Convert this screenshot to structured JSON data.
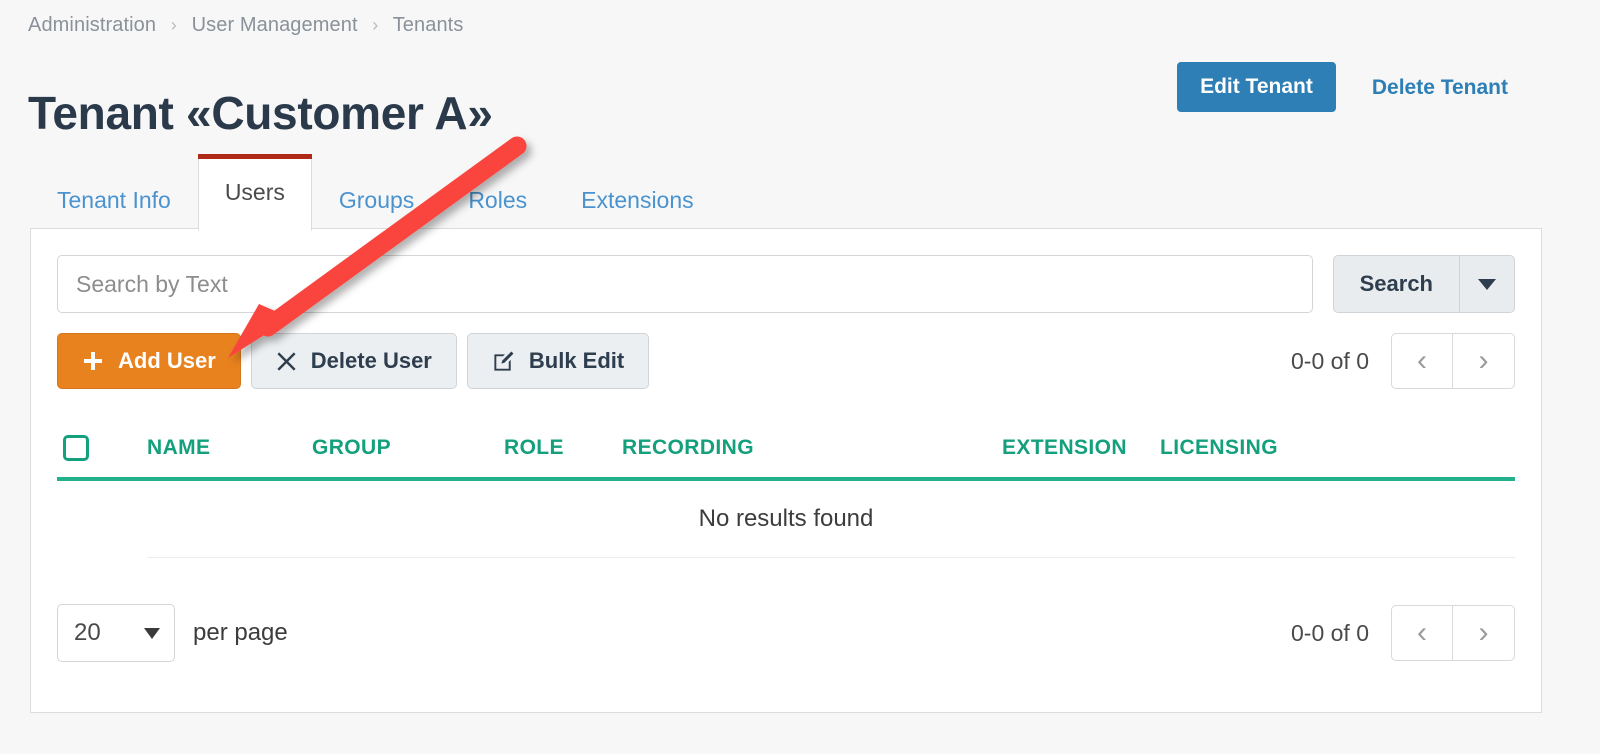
{
  "breadcrumb": {
    "items": [
      {
        "label": "Administration"
      },
      {
        "label": "User Management"
      },
      {
        "label": "Tenants"
      }
    ],
    "separator": "›"
  },
  "header": {
    "title": "Tenant «Customer A»",
    "edit_label": "Edit Tenant",
    "delete_label": "Delete Tenant",
    "primary_color": "#2d7fb5",
    "link_color": "#2d7fb5"
  },
  "tabs": [
    {
      "label": "Tenant Info",
      "active": false
    },
    {
      "label": "Users",
      "active": true
    },
    {
      "label": "Groups",
      "active": false
    },
    {
      "label": "Roles",
      "active": false
    },
    {
      "label": "Extensions",
      "active": false
    }
  ],
  "tab_active_border_color": "#b02b17",
  "search": {
    "value": "",
    "placeholder": "Search by Text",
    "button_label": "Search",
    "dropdown_icon": "caret-down-icon"
  },
  "actions": {
    "add_user": {
      "label": "Add User",
      "icon": "plus-icon",
      "color": "#e8821e"
    },
    "delete_user": {
      "label": "Delete User",
      "icon": "times-icon"
    },
    "bulk_edit": {
      "label": "Bulk Edit",
      "icon": "pencil-square-icon"
    }
  },
  "pagination_top": {
    "count_label": "0-0 of 0",
    "prev_icon": "chevron-left-icon",
    "next_icon": "chevron-right-icon"
  },
  "table": {
    "select_all_icon": "checkbox-unchecked-icon",
    "header_color": "#14a07c",
    "columns": [
      {
        "label": "NAME"
      },
      {
        "label": "GROUP"
      },
      {
        "label": "ROLE"
      },
      {
        "label": "RECORDING"
      },
      {
        "label": "EXTENSION"
      },
      {
        "label": "LICENSING"
      }
    ],
    "rows": [],
    "empty_message": "No results found"
  },
  "footer": {
    "per_page_value": "20",
    "per_page_label": "per page",
    "count_label": "0-0 of 0",
    "prev_icon": "chevron-left-icon",
    "next_icon": "chevron-right-icon"
  },
  "annotation": {
    "type": "arrow",
    "color": "#f9443c",
    "points_to": "add-user-button"
  }
}
